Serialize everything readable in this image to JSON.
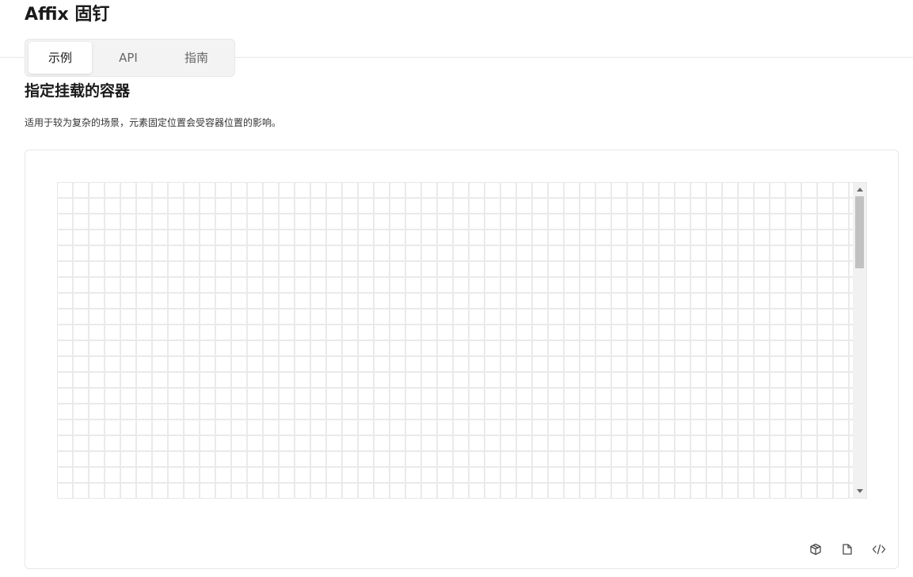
{
  "page": {
    "title": "Affix 固钉"
  },
  "tabs": [
    {
      "label": "示例",
      "active": true
    },
    {
      "label": "API",
      "active": false
    },
    {
      "label": "指南",
      "active": false
    }
  ],
  "section": {
    "title": "指定挂载的容器",
    "description": "适用于较为复杂的场景，元素固定位置会受容器位置的影响。"
  },
  "demo": {
    "scrollbar": {
      "position_fraction": 0.0,
      "visible_fraction": 0.25
    },
    "actions": [
      {
        "icon": "sandbox-cube-icon"
      },
      {
        "icon": "copy-icon"
      },
      {
        "icon": "code-icon"
      }
    ]
  },
  "colors": {
    "grid_line": "#eaeaea",
    "border": "#e7e7e7",
    "tab_bg": "#f3f3f3",
    "scroll_thumb": "#c1c1c1"
  }
}
